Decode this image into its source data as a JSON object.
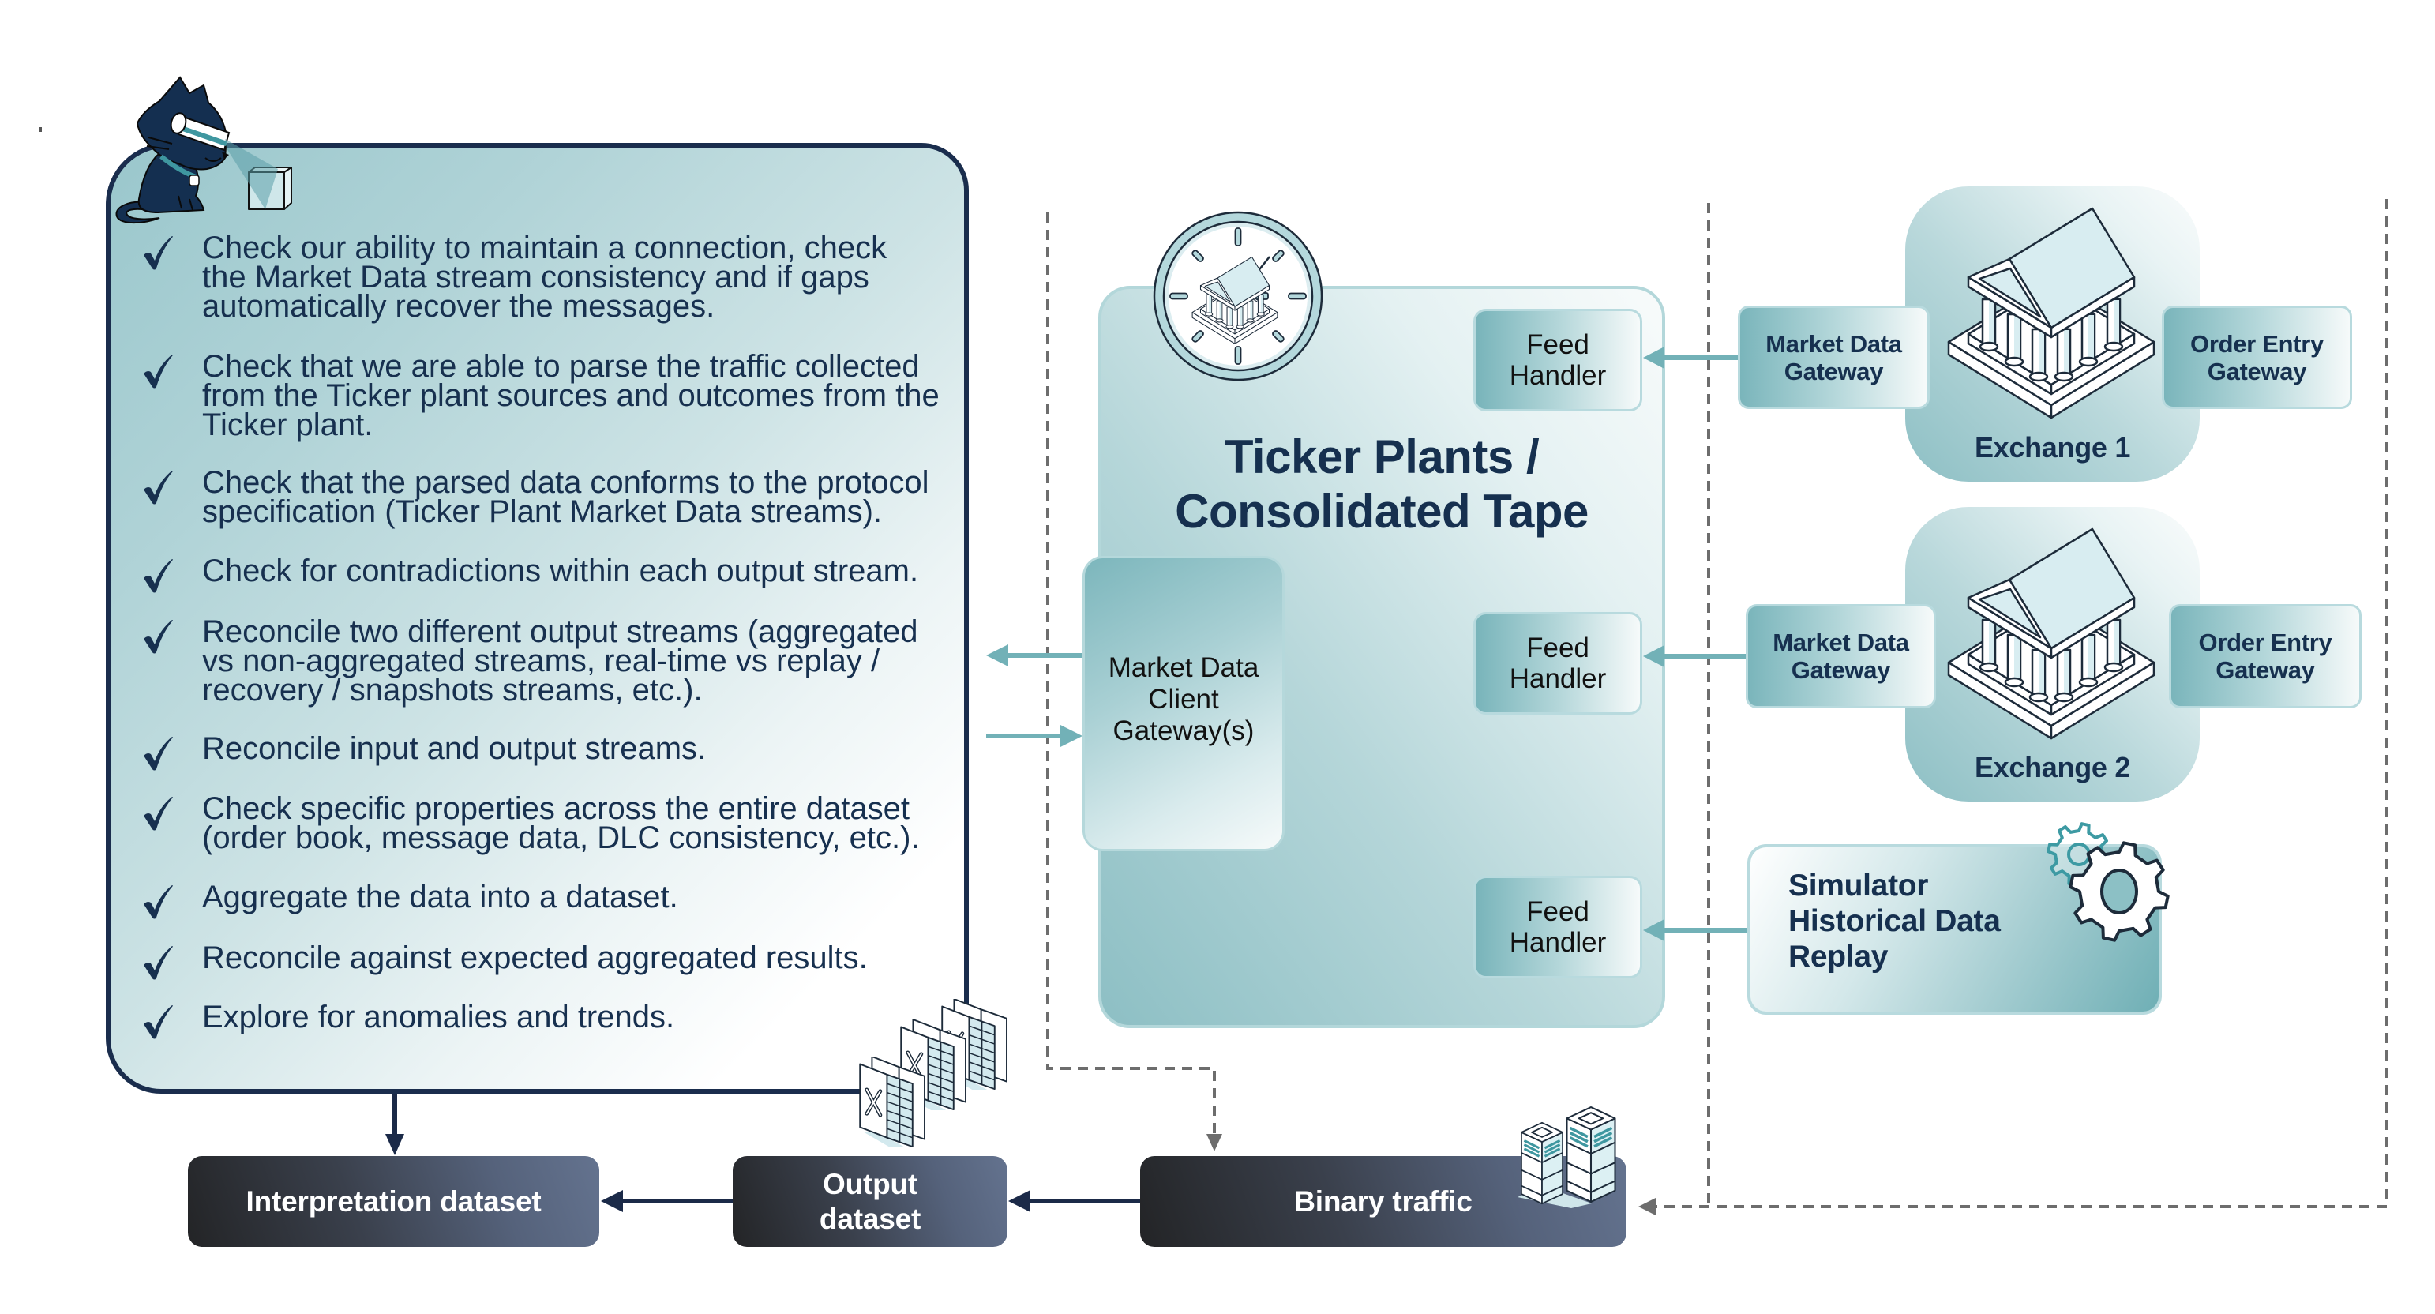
{
  "checks": {
    "items": [
      {
        "lines": [
          "Check our ability to maintain a connection, check",
          "the Market Data stream consistency and if gaps",
          "automatically recover the messages."
        ]
      },
      {
        "lines": [
          "Check that we are able to parse the traffic collected",
          "from the Ticker plant sources and outcomes from the",
          "Ticker plant."
        ]
      },
      {
        "lines": [
          "Check that the parsed data conforms to the protocol",
          "specification (Ticker Plant Market Data streams)."
        ]
      },
      {
        "lines": [
          "Check for contradictions within each output stream."
        ]
      },
      {
        "lines": [
          "Reconcile two different output streams (aggregated",
          "vs non-aggregated streams, real-time vs replay /",
          "recovery / snapshots streams, etc.)."
        ]
      },
      {
        "lines": [
          "Reconcile input and output streams."
        ]
      },
      {
        "lines": [
          "Check specific properties across the entire dataset",
          "(order book, message data, DLC consistency, etc.)."
        ]
      },
      {
        "lines": [
          "Aggregate the data into a dataset."
        ]
      },
      {
        "lines": [
          "Reconcile against expected aggregated results."
        ]
      },
      {
        "lines": [
          "Explore for anomalies and trends."
        ]
      }
    ]
  },
  "ticker_plant": {
    "title": [
      "Ticker Plants /",
      "Consolidated Tape"
    ],
    "client_gateway": [
      "Market Data",
      "Client",
      "Gateway(s)"
    ],
    "feed_handlers": [
      [
        "Feed",
        "Handler"
      ],
      [
        "Feed",
        "Handler"
      ],
      [
        "Feed",
        "Handler"
      ]
    ]
  },
  "exchanges": [
    {
      "name": "Exchange 1",
      "market_data_gateway": [
        "Market Data",
        "Gateway"
      ],
      "order_entry_gateway": [
        "Order Entry",
        "Gateway"
      ]
    },
    {
      "name": "Exchange 2",
      "market_data_gateway": [
        "Market Data",
        "Gateway"
      ],
      "order_entry_gateway": [
        "Order Entry",
        "Gateway"
      ]
    }
  ],
  "simulator": {
    "label": [
      "Simulator",
      "Historical Data",
      "Replay"
    ]
  },
  "datasets": {
    "interpretation": [
      "Interpretation dataset"
    ],
    "output": [
      "Output",
      "dataset"
    ],
    "binary_traffic": [
      "Binary traffic"
    ]
  },
  "icons": {
    "mascot": "cat-mascot-icon",
    "inspected_object": "cube-icon",
    "check": "checkmark-icon",
    "ticker_plant": "clock-exchange-icon",
    "exchange": "exchange-building-icon",
    "simulator": "gears-icon",
    "output_files": "spreadsheet-files-icon",
    "binary_traffic": "server-icon"
  },
  "colors": {
    "navy_text": "#16304f",
    "panel_border": "#1a2d4d",
    "teal_connector": "#72b1b7",
    "teal_border": "#b3d7da",
    "dark_box": "#3a404c",
    "dark_connector": "#1b2a48",
    "dashed_connector": "#6d6d6d"
  }
}
